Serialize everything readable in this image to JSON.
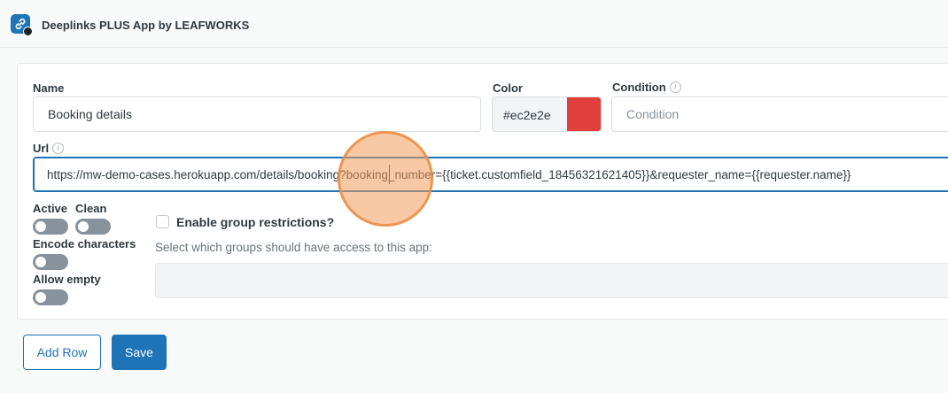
{
  "header": {
    "app_title": "Deeplinks PLUS App by LEAFWORKS",
    "app_icon": "link-icon"
  },
  "form": {
    "name": {
      "label": "Name",
      "value": "Booking details"
    },
    "color": {
      "label": "Color",
      "value": "#ec2e2e",
      "swatch": "#e0403b"
    },
    "condition": {
      "label": "Condition",
      "placeholder": "Condition",
      "value": ""
    },
    "url": {
      "label": "Url",
      "value": "https://mw-demo-cases.herokuapp.com/details/booking?booking_number={{ticket.customfield_18456321621405}}&requester_name={{requester.name}}"
    },
    "toggles": [
      {
        "label": "Active",
        "on": false
      },
      {
        "label": "Clean",
        "on": false
      },
      {
        "label": "Encode characters",
        "on": false
      },
      {
        "label": "Allow empty",
        "on": false
      }
    ],
    "group_restrictions": {
      "label": "Enable group restrictions?",
      "checked": false,
      "hint": "Select which groups should have access to this app:",
      "value": ""
    }
  },
  "actions": {
    "add_row": "Add Row",
    "save": "Save"
  },
  "colors": {
    "accent": "#1f73b7",
    "cursor_highlight": "#f39c5a"
  }
}
